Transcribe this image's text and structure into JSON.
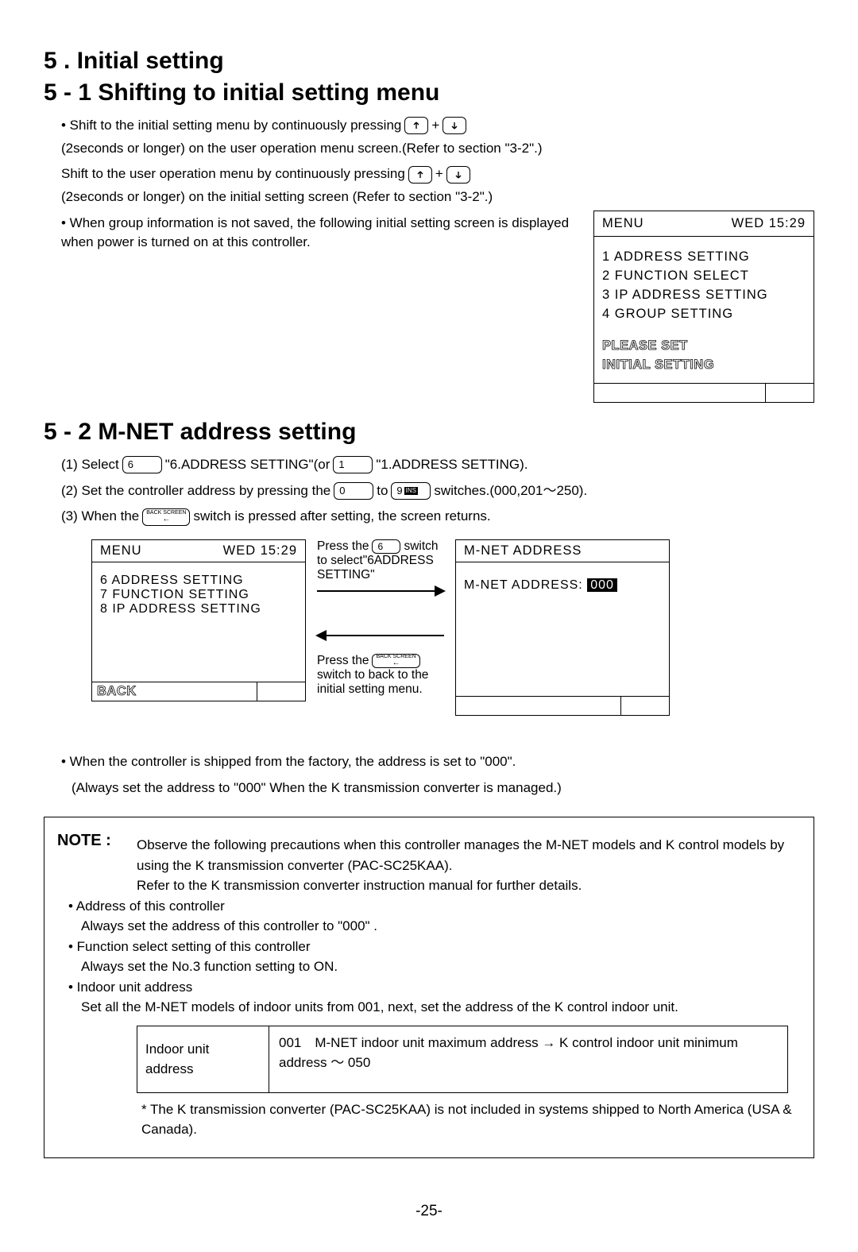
{
  "h1": "5 . Initial setting",
  "h2_1": "5 - 1 Shifting to initial setting menu",
  "p1_a": "• Shift to the initial setting menu by continuously pressing",
  "plus": " + ",
  "p1_b": "(2seconds or longer) on the user operation menu screen.(Refer to section \"3-2\".)",
  "p2_a": "Shift to the user operation menu by continuously pressing",
  "p2_b": "(2seconds or longer) on the initial setting screen (Refer to section \"3-2\".)",
  "p3_a": "• When group information is not saved, the following initial setting screen is displayed when power is turned on at this controller.",
  "lcd1": {
    "top_left": "MENU",
    "top_right": "WED 15:29",
    "items": [
      "1  ADDRESS SETTING",
      "2  FUNCTION SELECT",
      "3  IP  ADDRESS  SETTING",
      "4  GROUP SETTING"
    ],
    "prompt1": "PLEASE SET",
    "prompt2": "INITIAL SETTING"
  },
  "h2_2": "5 - 2 M-NET address setting",
  "s1_a": "(1) Select",
  "key6": "6",
  "s1_b": "\"6.ADDRESS SETTING\"(or",
  "key1": "1",
  "s1_c": "\"1.ADDRESS SETTING).",
  "s2_a": "(2) Set the controller address by pressing the",
  "key0": "0",
  "s2_to": "to",
  "key9": "9",
  "ins": "INS",
  "s2_b": "switches.(000,201～250).",
  "s3_a": "(3) When the",
  "back_screen": "BACK SCREEN",
  "s3_b": "switch is pressed after setting, the screen returns.",
  "flow": {
    "top_a": "Press the",
    "top_b": "switch",
    "top_c": "to select\"6ADDRESS SETTING\"",
    "bot_a": "Press the",
    "bot_b": "switch to back to the initial setting menu."
  },
  "lcd2": {
    "top_left": "MENU",
    "top_right": "WED 15:29",
    "items": [
      "6  ADDRESS SETTING",
      "7  FUNCTION SETTING",
      "8  IP  ADDRESS  SETTING"
    ],
    "back": "BACK"
  },
  "lcd3": {
    "title": "M-NET  ADDRESS",
    "label": "M-NET  ADDRESS:",
    "value": "000"
  },
  "post1": "• When the controller is shipped from the factory, the address is set to \"000\".",
  "post2": "(Always set the address to \"000\" When the K transmission converter is managed.)",
  "note": {
    "label": "NOTE :",
    "l1": "Observe the following precautions when this controller manages the M-NET models and K control models by using the K transmission converter (PAC-SC25KAA).",
    "l2": "Refer to the K transmission converter instruction manual for further details.",
    "b1": "• Address of this controller",
    "b1d": "Always set the address of this controller to \"000\" .",
    "b2": "• Function select setting of this controller",
    "b2d": "Always set the No.3 function setting to ON.",
    "b3": "• Indoor unit address",
    "b3d": "Set all the M-NET models of indoor units from 001, next, set the address of the K control indoor unit.",
    "table_label": "Indoor unit address",
    "table_val": "001　M-NET indoor unit maximum address → K control indoor unit minimum address ～ 050",
    "foot": "* The K transmission converter (PAC-SC25KAA) is not included in systems shipped to North America (USA & Canada)."
  },
  "page": "-25-"
}
